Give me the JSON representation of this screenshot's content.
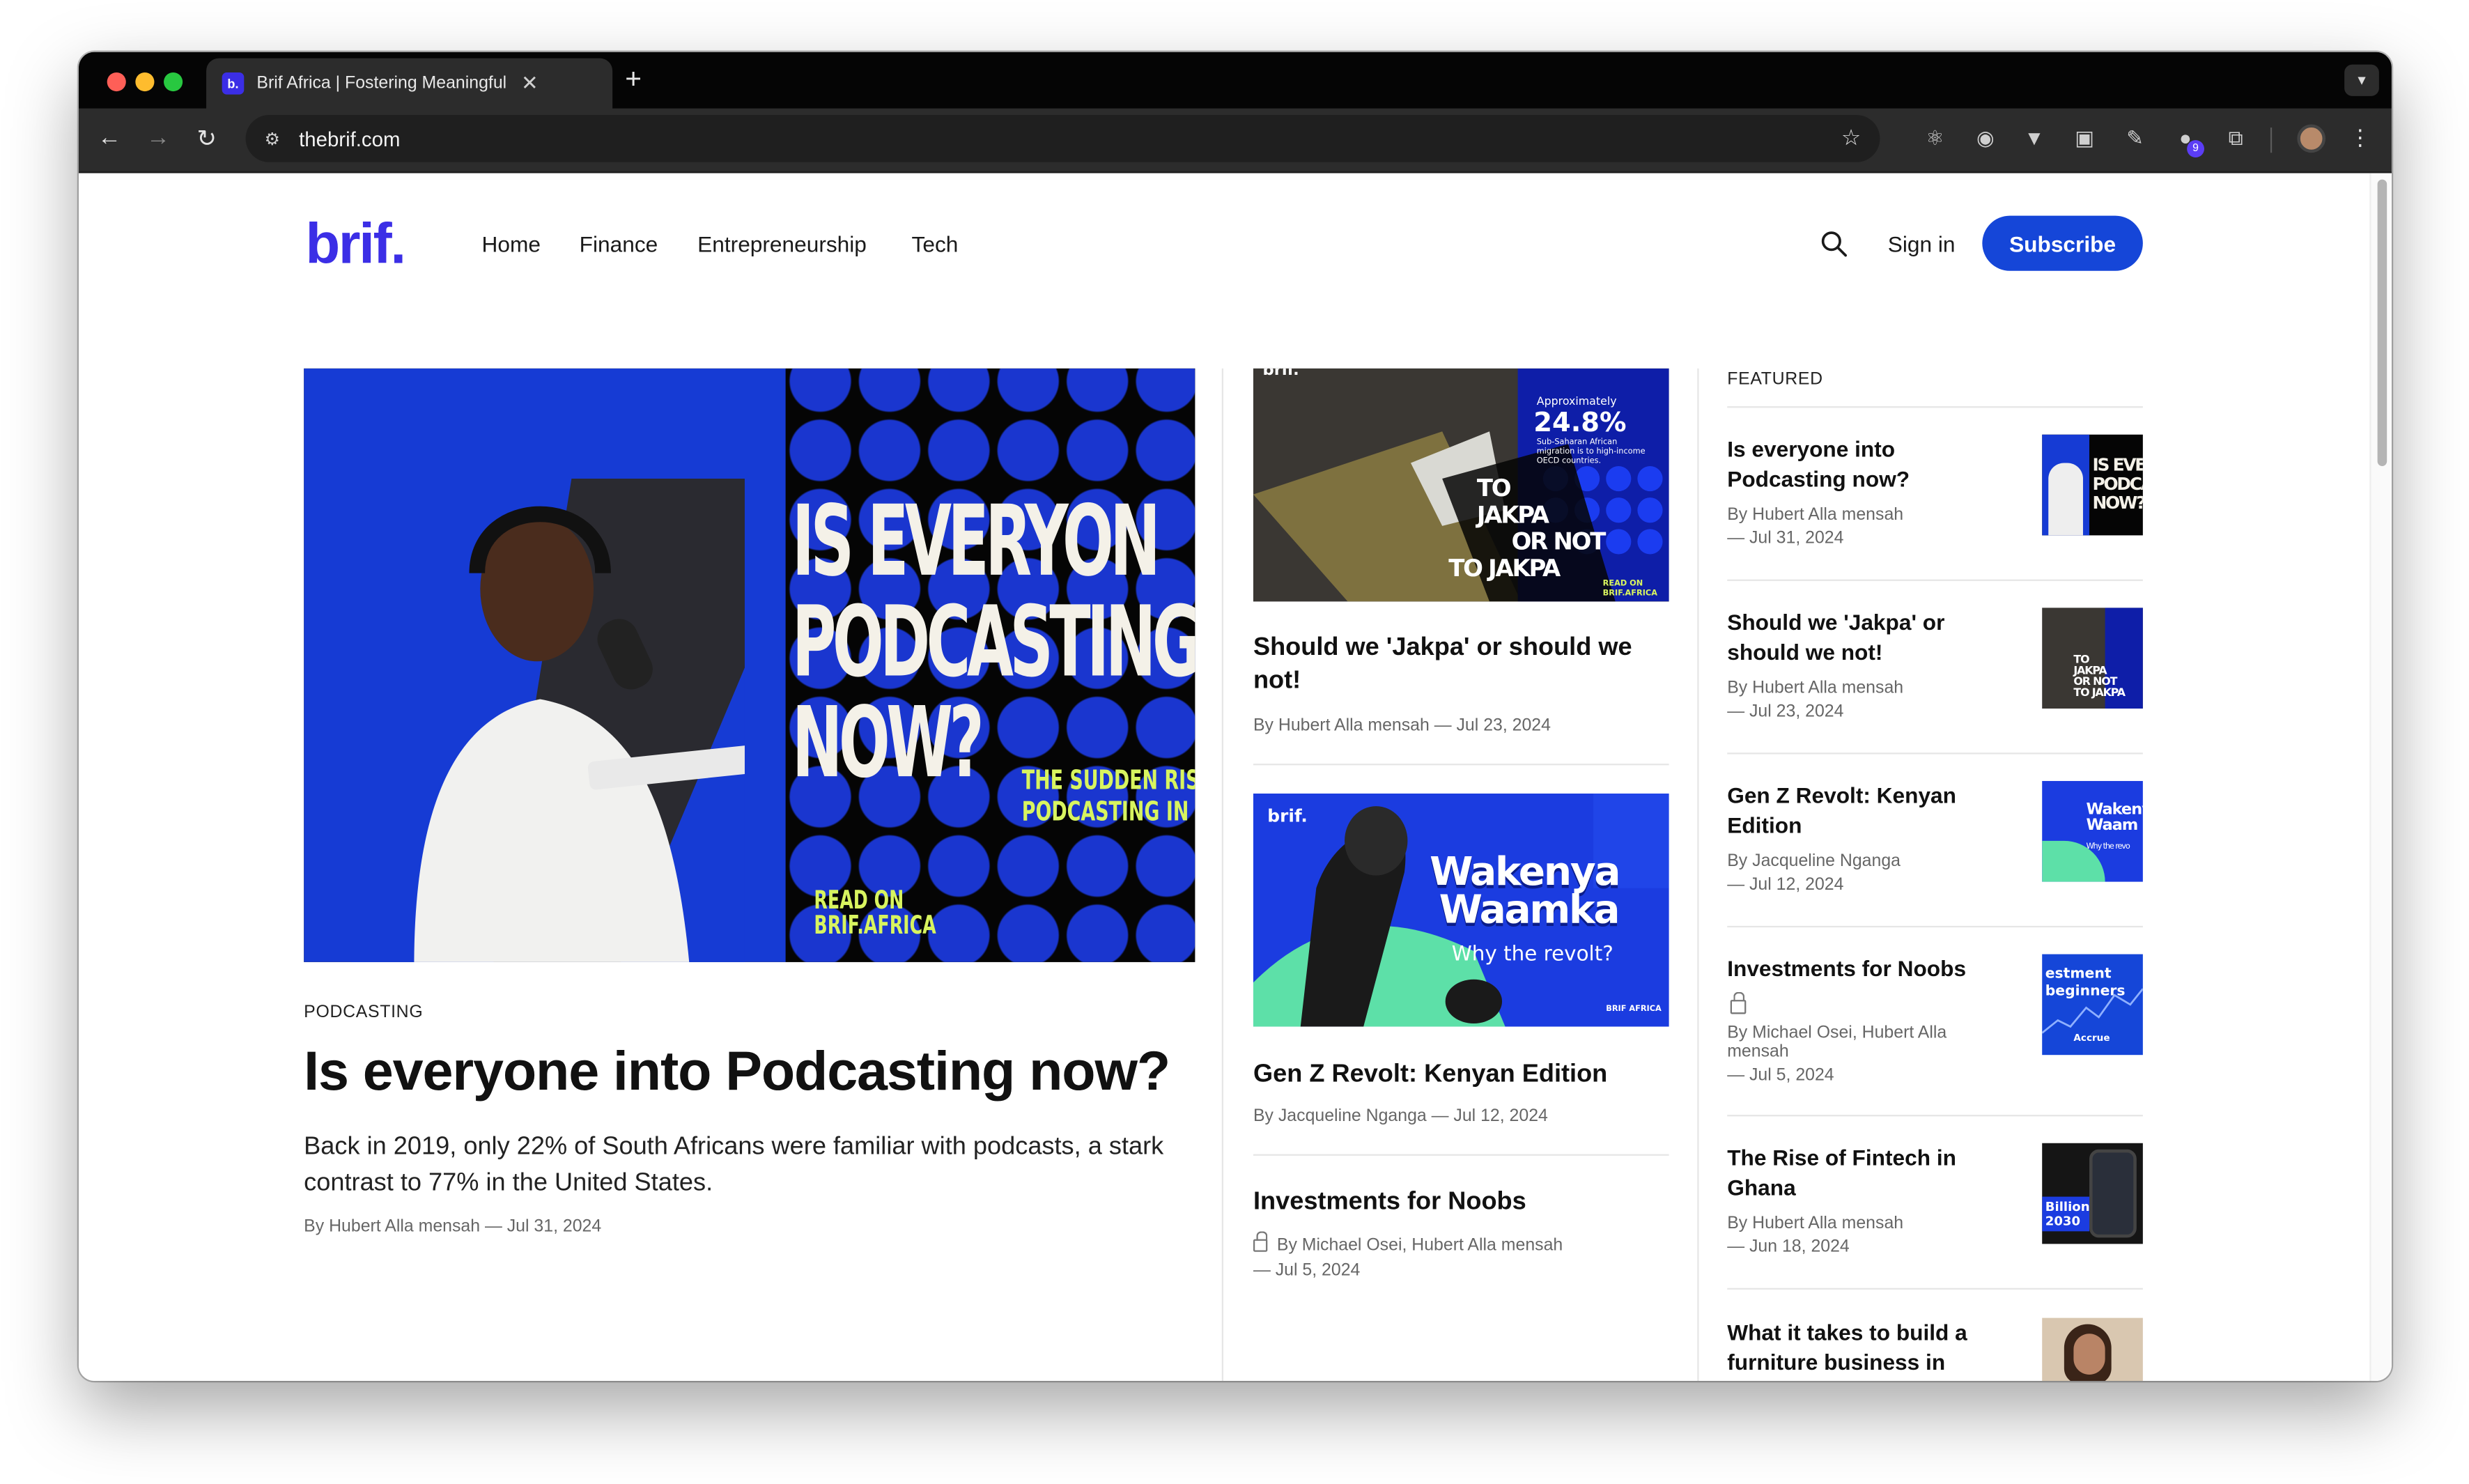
{
  "browser": {
    "tab_title": "Brif Africa | Fostering Meaningful",
    "tab_favicon": "b.",
    "url": "thebrif.com",
    "extension_badge": "9"
  },
  "site": {
    "logo": "brif.",
    "nav": [
      "Home",
      "Finance",
      "Entrepreneurship",
      "Tech"
    ],
    "signin": "Sign in",
    "subscribe": "Subscribe"
  },
  "hero": {
    "image_headline_lines": [
      "IS EVERYON",
      "PODCASTING",
      "NOW?"
    ],
    "image_sub_lines": [
      "THE SUDDEN RISE",
      "PODCASTING IN A"
    ],
    "image_read_lines": [
      "READ ON",
      "BRIF.AFRICA"
    ],
    "tag": "PODCASTING",
    "title": "Is everyone into Podcasting now?",
    "excerpt": "Back in 2019, only 22% of South Africans were familiar with podcasts, a stark contrast to 77% in the United States.",
    "meta": "By Hubert Alla mensah — Jul 31, 2024"
  },
  "cards": [
    {
      "image": {
        "brand": "brif.",
        "approx": "Approximately",
        "stat": "24.8%",
        "stat_caption": "Sub-Saharan African migration is to high-income OECD countries.",
        "headline_lines": [
          "TO",
          "JAKPA",
          "OR NOT",
          "TO JAKPA"
        ],
        "read": "READ ON BRIF.AFRICA"
      },
      "title": "Should we 'Jakpa' or should we not!",
      "meta": "By Hubert Alla mensah — Jul 23, 2024"
    },
    {
      "image": {
        "brand": "brif.",
        "headline_lines": [
          "Wakenya",
          "Waamka"
        ],
        "sub": "Why the revolt?",
        "footer": "BRIF AFRICA"
      },
      "title": "Gen Z Revolt: Kenyan Edition",
      "meta": "By Jacqueline Nganga — Jul 12, 2024"
    },
    {
      "title": "Investments for Noobs",
      "meta_line1": "By Michael Osei, Hubert Alla mensah",
      "meta_line2": "— Jul 5, 2024"
    }
  ],
  "featured": {
    "heading": "FEATURED",
    "items": [
      {
        "title": "Is everyone into Podcasting now?",
        "author": "By Hubert Alla mensah",
        "date": "— Jul 31, 2024",
        "thumb_text": [
          "IS EVER",
          "PODCAS",
          "NOW?"
        ]
      },
      {
        "title": "Should we 'Jakpa' or should we not!",
        "author": "By Hubert Alla mensah",
        "date": "— Jul 23, 2024",
        "thumb_text": [
          "TO",
          "JAKPA",
          "OR NOT",
          "TO JAKPA"
        ]
      },
      {
        "title": "Gen Z Revolt: Kenyan Edition",
        "author": "By Jacqueline Nganga",
        "date": "— Jul 12, 2024",
        "thumb_text": [
          "Wakeny",
          "Waam",
          "Why the revo"
        ]
      },
      {
        "title": "Investments for Noobs",
        "author": "By Michael Osei, Hubert Alla mensah",
        "date": "— Jul 5, 2024",
        "thumb_text": [
          "estment",
          "beginners",
          "Accrue"
        ]
      },
      {
        "title": "The Rise of Fintech in Ghana",
        "author": "By Hubert Alla mensah",
        "date": "— Jun 18, 2024",
        "thumb_text": [
          "Billion",
          "2030"
        ]
      },
      {
        "title": "What it takes to build a furniture business in"
      }
    ]
  },
  "colors": {
    "brand": "#3b2ee6",
    "subscribe": "#1546d8",
    "hero_blue": "#163bd4",
    "accent_yellow": "#d8f45f"
  }
}
